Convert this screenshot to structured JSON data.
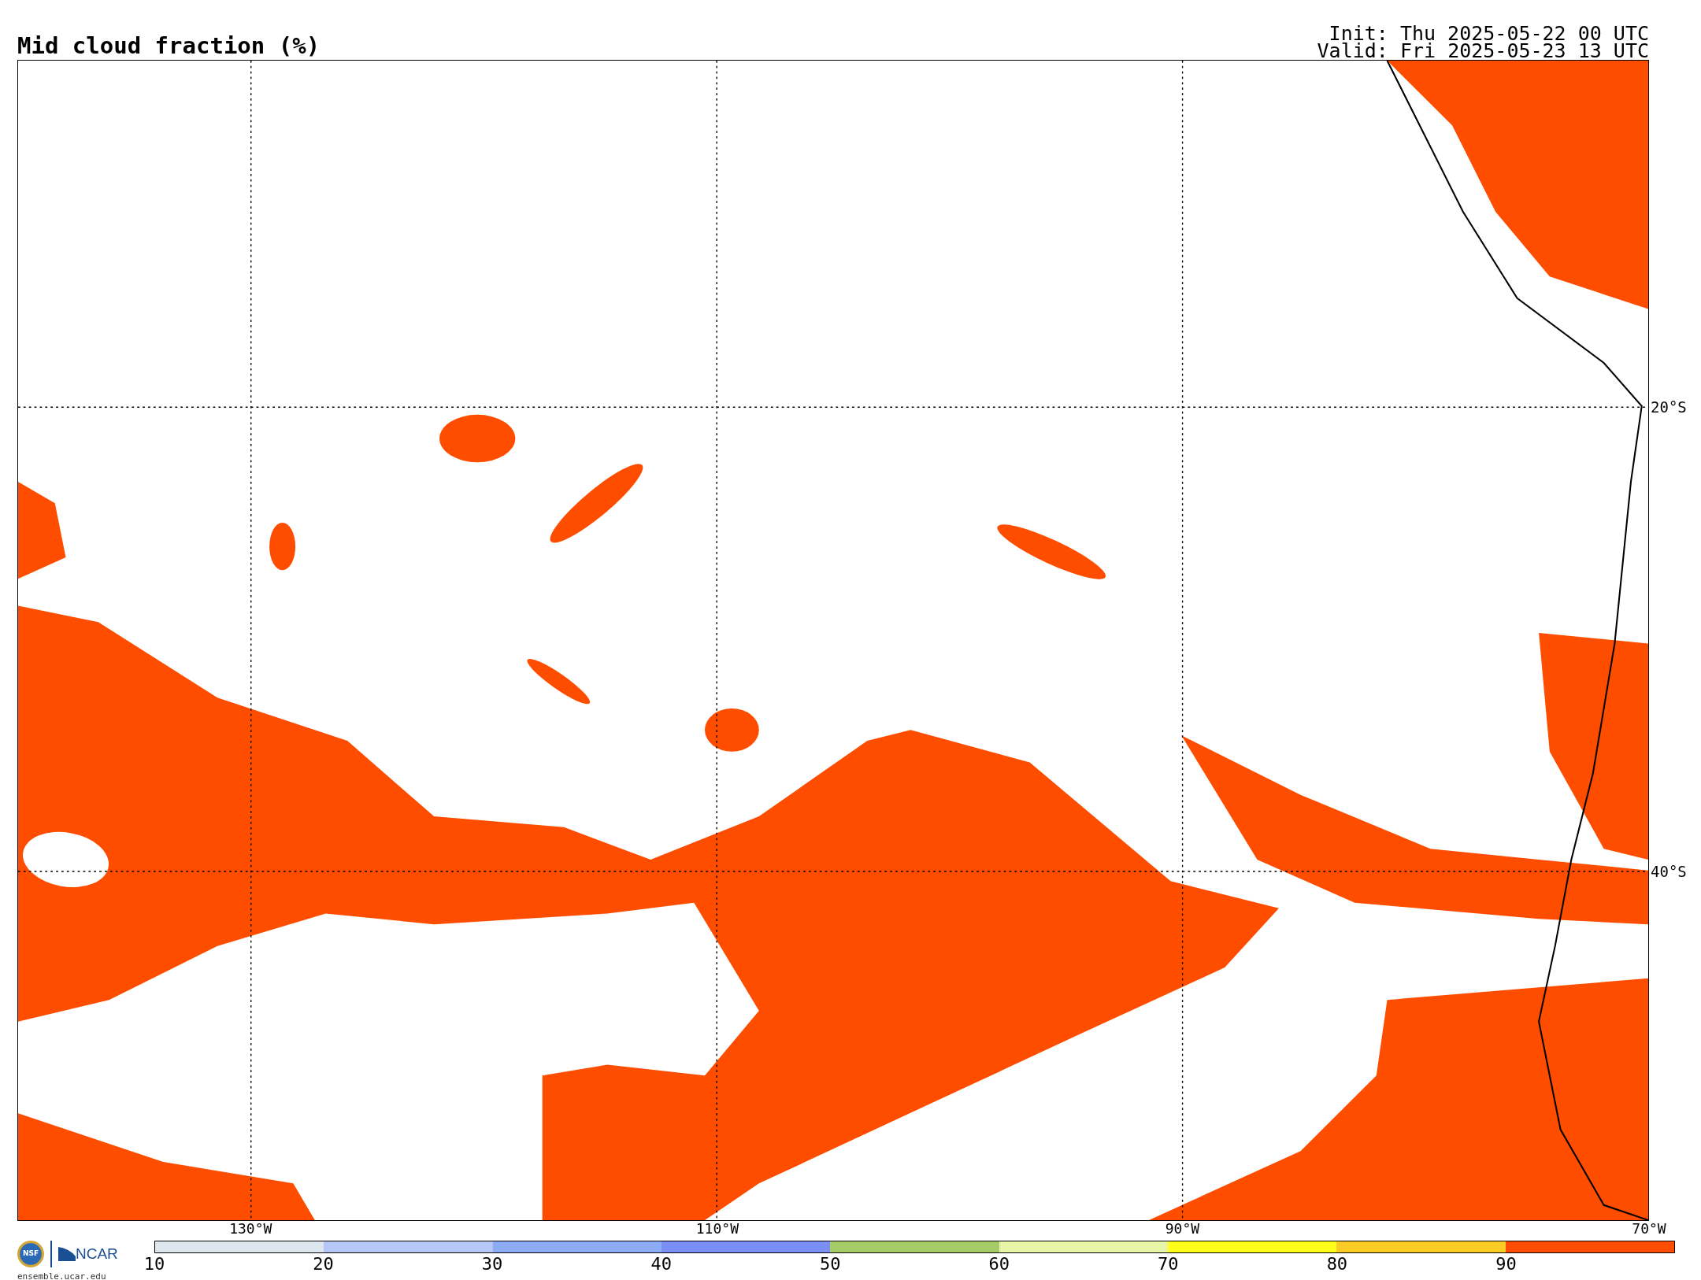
{
  "title": "Mid cloud fraction (%)",
  "init": "Init: Thu 2025-05-22 00 UTC",
  "valid": "Valid: Fri 2025-05-23 13 UTC",
  "map": {
    "lon_labels": [
      "130°W",
      "110°W",
      "90°W",
      "70°W"
    ],
    "lat_labels": [
      "20°S",
      "40°S"
    ]
  },
  "colorbar": {
    "bins": [
      {
        "color": "#dde6ee"
      },
      {
        "color": "#b5c8f5"
      },
      {
        "color": "#8dabf6"
      },
      {
        "color": "#7a8ef6"
      },
      {
        "color": "#a6cc66"
      },
      {
        "color": "#e8f5a6"
      },
      {
        "color": "#ffff1a"
      },
      {
        "color": "#ffcc26"
      },
      {
        "color": "#ff4d00"
      }
    ],
    "ticks": [
      "10",
      "20",
      "30",
      "40",
      "50",
      "60",
      "70",
      "80",
      "90"
    ]
  },
  "logo": {
    "seal": "NSF",
    "org": "NCAR",
    "url": "ensemble.ucar.edu"
  }
}
